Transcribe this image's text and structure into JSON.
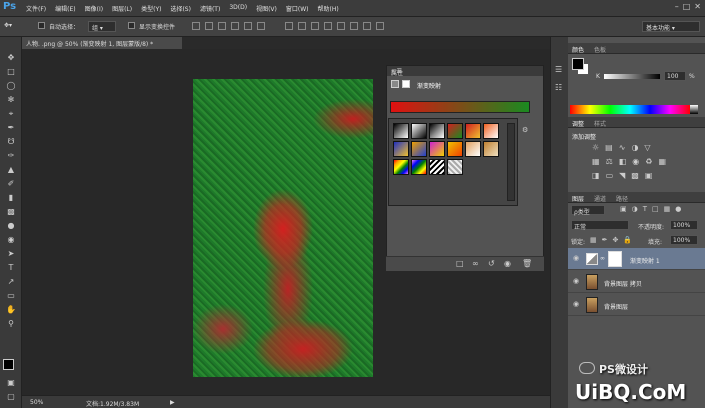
{
  "app": {
    "logo": "Ps"
  },
  "menu": [
    "文件(F)",
    "编辑(E)",
    "图像(I)",
    "图层(L)",
    "类型(Y)",
    "选择(S)",
    "滤镜(T)",
    "3D(D)",
    "视图(V)",
    "窗口(W)",
    "帮助(H)"
  ],
  "options": {
    "auto_select_label": "自动选择：",
    "auto_select_value": "组",
    "show_transform_label": "显示变换控件",
    "workspace": "基本功能"
  },
  "document": {
    "tab_title": "人物. .png @ 50% (渐变映射 1, 图层蒙版/8) *"
  },
  "status": {
    "zoom": "50%",
    "doc_info": "文档:1.92M/3.83M"
  },
  "properties": {
    "title": "属性",
    "subtitle": "渐变映射",
    "gradient_colors": [
      "#e01010",
      "#1a8a20"
    ]
  },
  "color_panel": {
    "tabs": [
      "颜色",
      "色板"
    ],
    "slider_label": "K",
    "slider_value": "100",
    "percent": "%"
  },
  "adjust_panel": {
    "tabs": [
      "调整",
      "样式"
    ],
    "title": "添加调整"
  },
  "layers_panel": {
    "tabs": [
      "图层",
      "通道",
      "路径"
    ],
    "filter": "ρ类型",
    "blend_mode": "正常",
    "opacity_label": "不透明度:",
    "opacity": "100%",
    "lock_label": "锁定:",
    "fill_label": "填充:",
    "fill": "100%",
    "layers": [
      {
        "name": "渐变映射 1"
      },
      {
        "name": "背景图层 拷贝"
      },
      {
        "name": "背景图层"
      }
    ]
  },
  "watermark": {
    "text1": "PS微设计",
    "text2": "UiBQ.CoM"
  }
}
